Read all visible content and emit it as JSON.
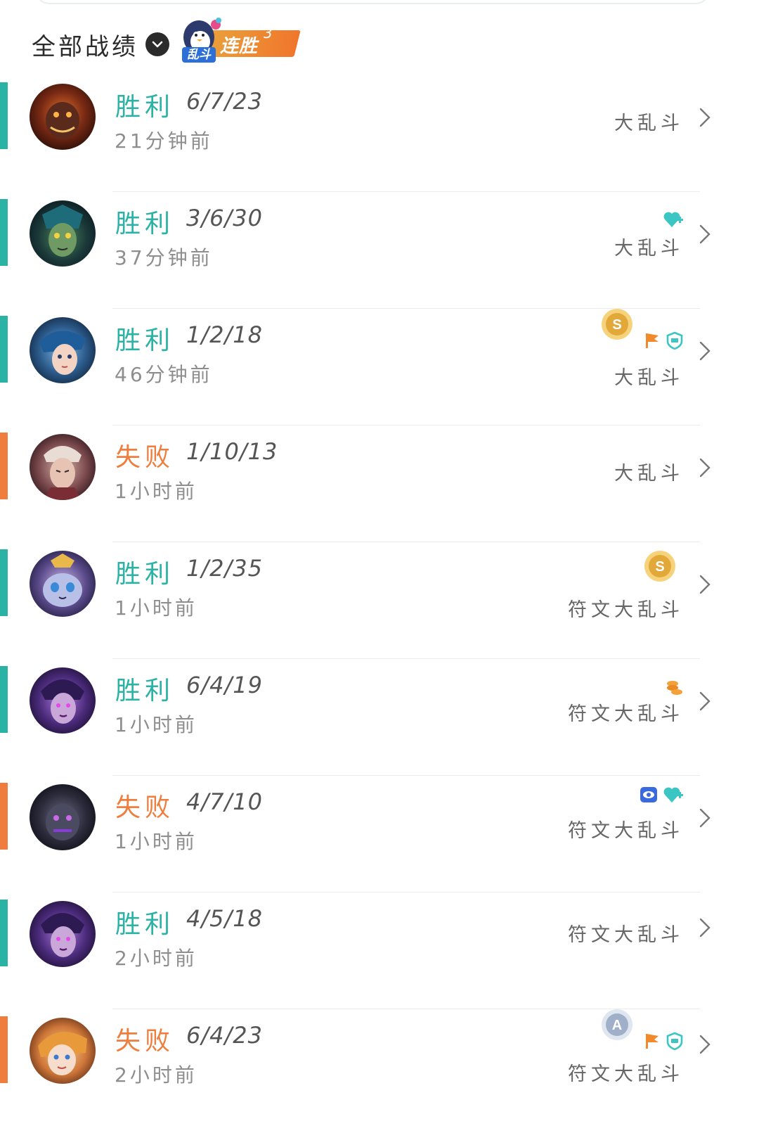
{
  "header": {
    "title": "全部战绩",
    "badge_tag": "乱斗",
    "badge_text": "连胜",
    "badge_count": "3"
  },
  "colors": {
    "win": "#2ab3a5",
    "loss": "#ef7e3e",
    "badge": "#f0762c"
  },
  "matches": [
    {
      "result": "胜利",
      "kda": "6/7/23",
      "time": "21分钟前",
      "mode": "大乱斗",
      "outcome": "win",
      "icons": []
    },
    {
      "result": "胜利",
      "kda": "3/6/30",
      "time": "37分钟前",
      "mode": "大乱斗",
      "outcome": "win",
      "icons": [
        "heart-plus-icon"
      ]
    },
    {
      "result": "胜利",
      "kda": "1/2/18",
      "time": "46分钟前",
      "mode": "大乱斗",
      "outcome": "win",
      "icons": [
        "gold-s-medal-icon",
        "flag-icon",
        "shield-icon"
      ]
    },
    {
      "result": "失败",
      "kda": "1/10/13",
      "time": "1小时前",
      "mode": "大乱斗",
      "outcome": "loss",
      "icons": []
    },
    {
      "result": "胜利",
      "kda": "1/2/35",
      "time": "1小时前",
      "mode": "符文大乱斗",
      "outcome": "win",
      "icons": [
        "gold-s-medal-icon"
      ]
    },
    {
      "result": "胜利",
      "kda": "6/4/19",
      "time": "1小时前",
      "mode": "符文大乱斗",
      "outcome": "win",
      "icons": [
        "coins-icon"
      ]
    },
    {
      "result": "失败",
      "kda": "4/7/10",
      "time": "1小时前",
      "mode": "符文大乱斗",
      "outcome": "loss",
      "icons": [
        "vision-icon",
        "heart-plus-icon"
      ]
    },
    {
      "result": "胜利",
      "kda": "4/5/18",
      "time": "2小时前",
      "mode": "符文大乱斗",
      "outcome": "win",
      "icons": []
    },
    {
      "result": "失败",
      "kda": "6/4/23",
      "time": "2小时前",
      "mode": "符文大乱斗",
      "outcome": "loss",
      "icons": [
        "silver-a-medal-icon",
        "flag-icon",
        "shield-icon"
      ]
    }
  ]
}
